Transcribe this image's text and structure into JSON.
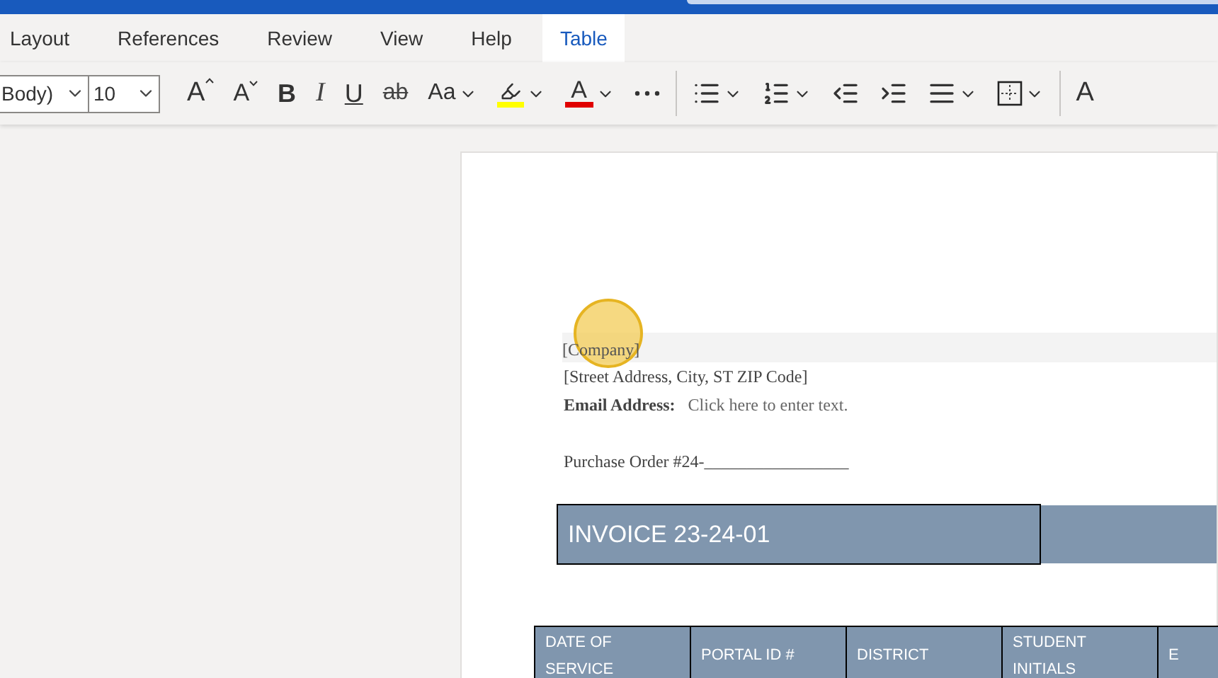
{
  "tabs": [
    {
      "label": "Layout",
      "selected": false
    },
    {
      "label": "References",
      "selected": false
    },
    {
      "label": "Review",
      "selected": false
    },
    {
      "label": "View",
      "selected": false
    },
    {
      "label": "Help",
      "selected": false
    },
    {
      "label": "Table",
      "selected": true
    }
  ],
  "toolbar": {
    "font_name": "Body)",
    "font_size": "10",
    "groups": [
      [
        {
          "kind": "grow",
          "label": "A",
          "dropdown": false
        },
        {
          "kind": "shrink",
          "label": "A",
          "dropdown": false
        },
        {
          "kind": "bold",
          "label": "B",
          "dropdown": false
        },
        {
          "kind": "italic",
          "label": "I",
          "dropdown": false
        },
        {
          "kind": "underline",
          "label": "U",
          "dropdown": false
        },
        {
          "kind": "strikethrough",
          "label": "ab",
          "dropdown": false
        },
        {
          "kind": "case",
          "label": "Aa",
          "dropdown": true
        },
        {
          "kind": "highlight",
          "dropdown": true
        },
        {
          "kind": "font_color",
          "label": "A",
          "dropdown": true
        },
        {
          "kind": "more",
          "dropdown": false
        }
      ],
      [
        {
          "kind": "bullets",
          "dropdown": true
        },
        {
          "kind": "numbering",
          "dropdown": true
        },
        {
          "kind": "outdent",
          "dropdown": false
        },
        {
          "kind": "indent",
          "dropdown": false
        },
        {
          "kind": "align",
          "dropdown": true
        },
        {
          "kind": "borders",
          "dropdown": true
        }
      ],
      [
        {
          "kind": "styles",
          "label": "A",
          "dropdown": false
        }
      ]
    ]
  },
  "document": {
    "company": "[Company]",
    "address": "[Street Address, City, ST ZIP Code]",
    "email_label": "Email Address:",
    "email_value": "Click here to enter text.",
    "purchase_order": "Purchase Order #24-_________________",
    "invoice_title": "INVOICE 23-24-01",
    "table": {
      "columns": [
        "DATE OF SERVICE",
        "PORTAL ID #",
        "DISTRICT",
        "STUDENT INITIALS",
        "E"
      ]
    }
  }
}
